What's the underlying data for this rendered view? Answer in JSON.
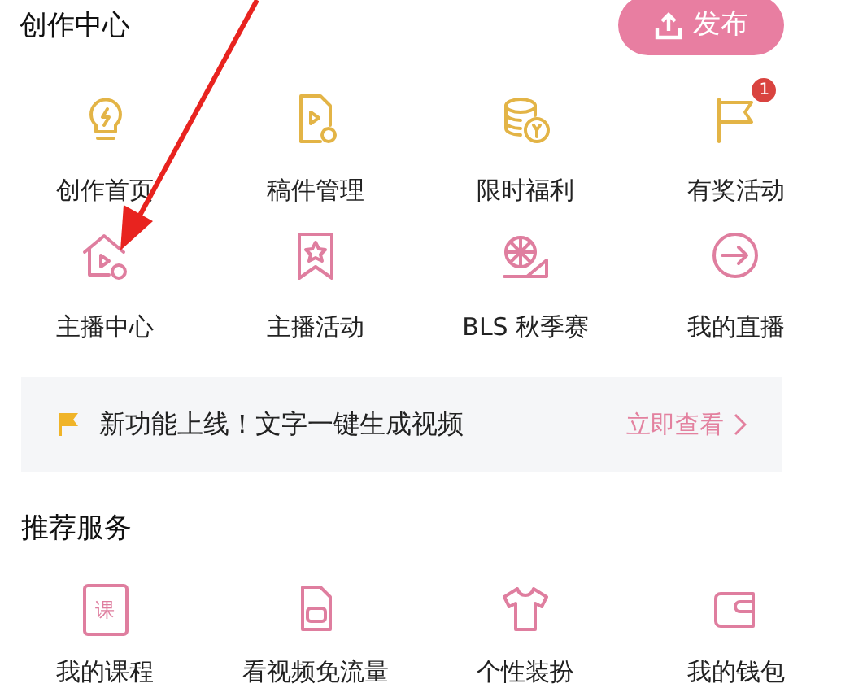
{
  "header": {
    "title": "创作中心",
    "publish_button": "发布"
  },
  "creation_items": [
    {
      "label": "创作首页"
    },
    {
      "label": "稿件管理"
    },
    {
      "label": "限时福利"
    },
    {
      "label": "有奖活动",
      "badge": "1"
    },
    {
      "label": "主播中心"
    },
    {
      "label": "主播活动"
    },
    {
      "label": "BLS 秋季赛"
    },
    {
      "label": "我的直播"
    }
  ],
  "banner": {
    "text": "新功能上线！文字一键生成视频",
    "link": "立即查看"
  },
  "services": {
    "title": "推荐服务",
    "items": [
      {
        "label": "我的课程",
        "icon_text": "课"
      },
      {
        "label": "看视频免流量"
      },
      {
        "label": "个性装扮"
      },
      {
        "label": "我的钱包"
      }
    ]
  }
}
